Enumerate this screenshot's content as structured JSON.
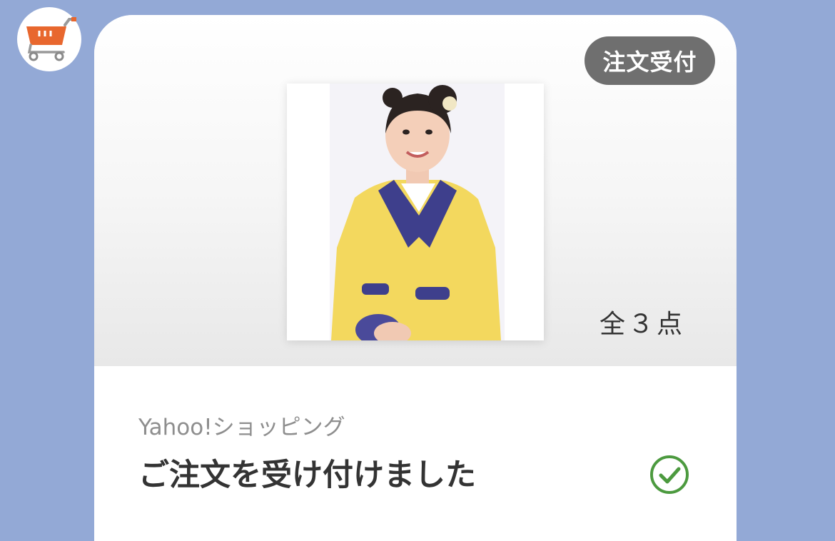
{
  "order_card": {
    "status_badge": "注文受付",
    "item_count": "全３点",
    "shop_name": "Yahoo!ショッピング",
    "message": "ご注文を受け付けました"
  },
  "icons": {
    "avatar": "shopping-cart-icon",
    "status": "check-circle-icon"
  },
  "colors": {
    "background": "#93a9d6",
    "badge": "#6f6f6f",
    "cart_orange": "#e8672e",
    "check_green": "#4c9a3f"
  }
}
